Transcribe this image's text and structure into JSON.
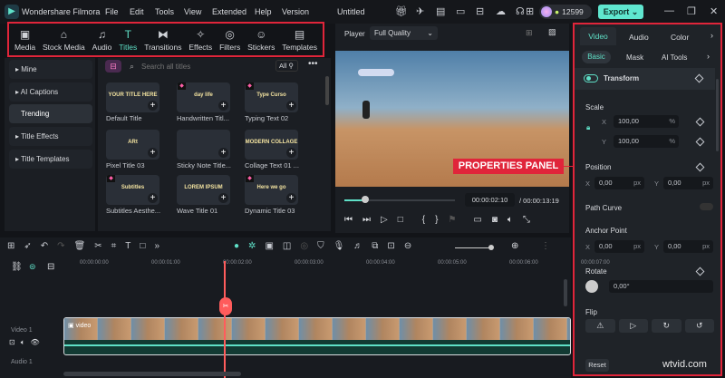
{
  "app": {
    "title": "Wondershare Filmora",
    "project": "Untitled",
    "credits": "12599",
    "export_label": "Export"
  },
  "menu": [
    "File",
    "Edit",
    "Tools",
    "View",
    "Extended",
    "Help",
    "Version"
  ],
  "toolbar": [
    {
      "label": "Media",
      "icon": "media-icon"
    },
    {
      "label": "Stock Media",
      "icon": "stock-media-icon"
    },
    {
      "label": "Audio",
      "icon": "music-note-icon"
    },
    {
      "label": "Titles",
      "icon": "titles-icon",
      "active": true
    },
    {
      "label": "Transitions",
      "icon": "transitions-icon"
    },
    {
      "label": "Effects",
      "icon": "effects-icon"
    },
    {
      "label": "Filters",
      "icon": "filters-icon"
    },
    {
      "label": "Stickers",
      "icon": "stickers-icon"
    },
    {
      "label": "Templates",
      "icon": "templates-icon"
    }
  ],
  "sidebar": [
    "Mine",
    "AI Captions",
    "Trending",
    "Title Effects",
    "Title Templates"
  ],
  "browser": {
    "search_placeholder": "Search all titles",
    "filter": "All",
    "items": [
      {
        "label": "Default Title",
        "preview": "YOUR TITLE HERE"
      },
      {
        "label": "Handwritten Titl...",
        "preview": "day life",
        "premium": true
      },
      {
        "label": "Typing Text 02",
        "preview": "Type Curso",
        "premium": true
      },
      {
        "label": "Pixel Title 03",
        "preview": "ARt"
      },
      {
        "label": "Sticky Note Title...",
        "preview": ""
      },
      {
        "label": "Collage Text 01 ...",
        "preview": "MODERN COLLAGE"
      },
      {
        "label": "Subtitles Aesthe...",
        "preview": "Subtitles",
        "premium": true
      },
      {
        "label": "Wave Title 01",
        "preview": "LOREM IPSUM"
      },
      {
        "label": "Dynamic Title 03",
        "preview": "Here we go",
        "premium": true
      }
    ]
  },
  "player": {
    "label": "Player",
    "quality": "Full Quality",
    "current_time": "00:00:02:10",
    "total_time": "/ 00:00:13:19",
    "progress": 0.19
  },
  "callout": "PROPERTIES PANEL",
  "properties": {
    "tabs": [
      "Video",
      "Audio",
      "Color"
    ],
    "subtabs": [
      "Basic",
      "Mask",
      "AI Tools"
    ],
    "transform": "Transform",
    "scale_label": "Scale",
    "scale_x": "100,00",
    "scale_y": "100,00",
    "percent": "%",
    "position_label": "Position",
    "pos_x": "0,00",
    "pos_y": "0,00",
    "unit": "px",
    "path_curve": "Path Curve",
    "anchor_label": "Anchor Point",
    "anchor_x": "0,00",
    "anchor_y": "0,00",
    "rotate_label": "Rotate",
    "rotate": "0,00°",
    "flip_label": "Flip",
    "reset": "Reset",
    "x": "X",
    "y": "Y"
  },
  "timeline": {
    "ticks": [
      "00:00:00:00",
      "00:00:01:00",
      "00:00:02:00",
      "00:00:03:00",
      "00:00:04:00",
      "00:00:05:00",
      "00:00:06:00",
      "00:00:07:00"
    ],
    "video_track": "Video 1",
    "audio_track": "Audio 1",
    "clip_label": "video"
  },
  "watermark": "wtvid.com"
}
